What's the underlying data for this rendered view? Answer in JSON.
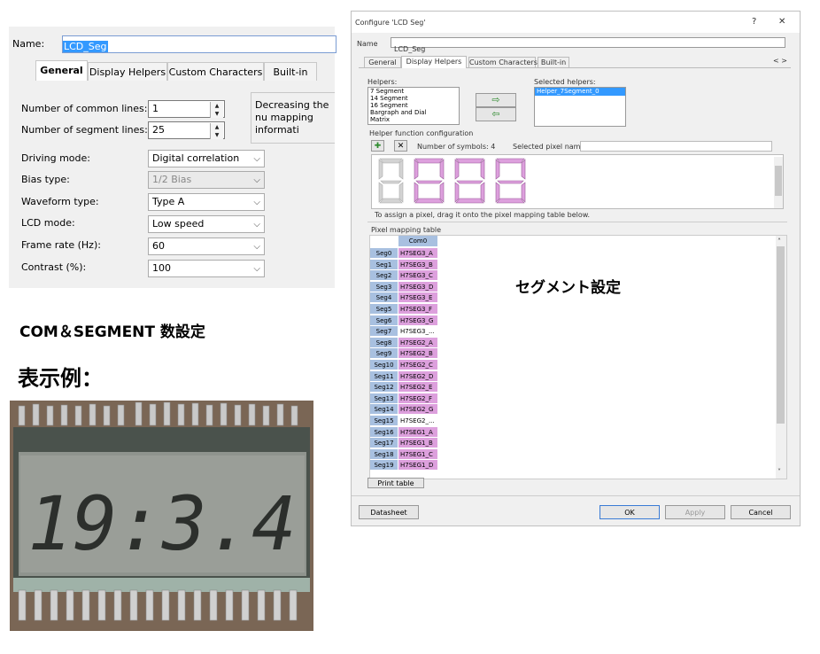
{
  "left_panel": {
    "name_label": "Name:",
    "name_value": "LCD_Seg",
    "tabs": [
      {
        "label": "General",
        "active": true
      },
      {
        "label": "Display Helpers",
        "active": false
      },
      {
        "label": "Custom Characters",
        "active": false
      },
      {
        "label": "Built-in",
        "active": false
      }
    ],
    "common_lines": {
      "label": "Number of common lines:",
      "value": "1"
    },
    "segment_lines": {
      "label": "Number of segment lines:",
      "value": "25"
    },
    "info_text": "Decreasing the nu mapping informati",
    "settings": [
      {
        "label": "Driving mode:",
        "value": "Digital correlation",
        "disabled": false
      },
      {
        "label": "Bias type:",
        "value": "1/2 Bias",
        "disabled": true
      },
      {
        "label": "Waveform type:",
        "value": "Type A",
        "disabled": false
      },
      {
        "label": "LCD mode:",
        "value": "Low speed",
        "disabled": false
      },
      {
        "label": "Frame rate (Hz):",
        "value": "60",
        "disabled": false
      },
      {
        "label": "Contrast (%):",
        "value": "100",
        "disabled": false
      }
    ]
  },
  "captions": {
    "com_segment": "COM＆SEGMENT 数設定",
    "display_example": "表示例：",
    "segment_setting": "セグメント設定"
  },
  "dialog": {
    "title": "Configure 'LCD Seg'",
    "help_glyph": "?",
    "close_glyph": "✕",
    "name_label": "Name",
    "name_value": "LCD_Seg",
    "tabs": [
      "General",
      "Display Helpers",
      "Custom Characters",
      "Built-in"
    ],
    "tab_scroll": "< >",
    "helpers_label": "Helpers:",
    "helpers": [
      "7 Segment",
      "14 Segment",
      "16 Segment",
      "Bargraph and Dial",
      "Matrix"
    ],
    "selected_helpers_label": "Selected helpers:",
    "selected_helpers": [
      "Helper_7Segment_0"
    ],
    "add_arrow": "⇨",
    "remove_arrow": "⇦",
    "config_label": "Helper function configuration",
    "num_symbols_label": "Number of symbols: 4",
    "selected_pixel_label": "Selected pixel name:",
    "add_icon": "✚",
    "delete_icon": "✕",
    "hint": "To assign a pixel, drag it onto the pixel mapping table below.",
    "pixel_table_label": "Pixel mapping table",
    "column": "Com0",
    "rows": [
      {
        "seg": "Seg0",
        "pixel": "H7SEG3_A",
        "white": false
      },
      {
        "seg": "Seg1",
        "pixel": "H7SEG3_B",
        "white": false
      },
      {
        "seg": "Seg2",
        "pixel": "H7SEG3_C",
        "white": false
      },
      {
        "seg": "Seg3",
        "pixel": "H7SEG3_D",
        "white": false
      },
      {
        "seg": "Seg4",
        "pixel": "H7SEG3_E",
        "white": false
      },
      {
        "seg": "Seg5",
        "pixel": "H7SEG3_F",
        "white": false
      },
      {
        "seg": "Seg6",
        "pixel": "H7SEG3_G",
        "white": false
      },
      {
        "seg": "Seg7",
        "pixel": "H7SEG3_...",
        "white": true
      },
      {
        "seg": "Seg8",
        "pixel": "H7SEG2_A",
        "white": false
      },
      {
        "seg": "Seg9",
        "pixel": "H7SEG2_B",
        "white": false
      },
      {
        "seg": "Seg10",
        "pixel": "H7SEG2_C",
        "white": false
      },
      {
        "seg": "Seg11",
        "pixel": "H7SEG2_D",
        "white": false
      },
      {
        "seg": "Seg12",
        "pixel": "H7SEG2_E",
        "white": false
      },
      {
        "seg": "Seg13",
        "pixel": "H7SEG2_F",
        "white": false
      },
      {
        "seg": "Seg14",
        "pixel": "H7SEG2_G",
        "white": false
      },
      {
        "seg": "Seg15",
        "pixel": "H7SEG2_...",
        "white": true
      },
      {
        "seg": "Seg16",
        "pixel": "H7SEG1_A",
        "white": false
      },
      {
        "seg": "Seg17",
        "pixel": "H7SEG1_B",
        "white": false
      },
      {
        "seg": "Seg18",
        "pixel": "H7SEG1_C",
        "white": false
      },
      {
        "seg": "Seg19",
        "pixel": "H7SEG1_D",
        "white": false
      }
    ],
    "print_table": "Print table",
    "datasheet": "Datasheet",
    "ok": "OK",
    "apply": "Apply",
    "cancel": "Cancel"
  },
  "lcd_photo": {
    "digits": "19:3.4"
  },
  "colors": {
    "selection_blue": "#3399ff",
    "segment_pink": "#dda0dd",
    "row_head_blue": "#a8c0e0"
  }
}
